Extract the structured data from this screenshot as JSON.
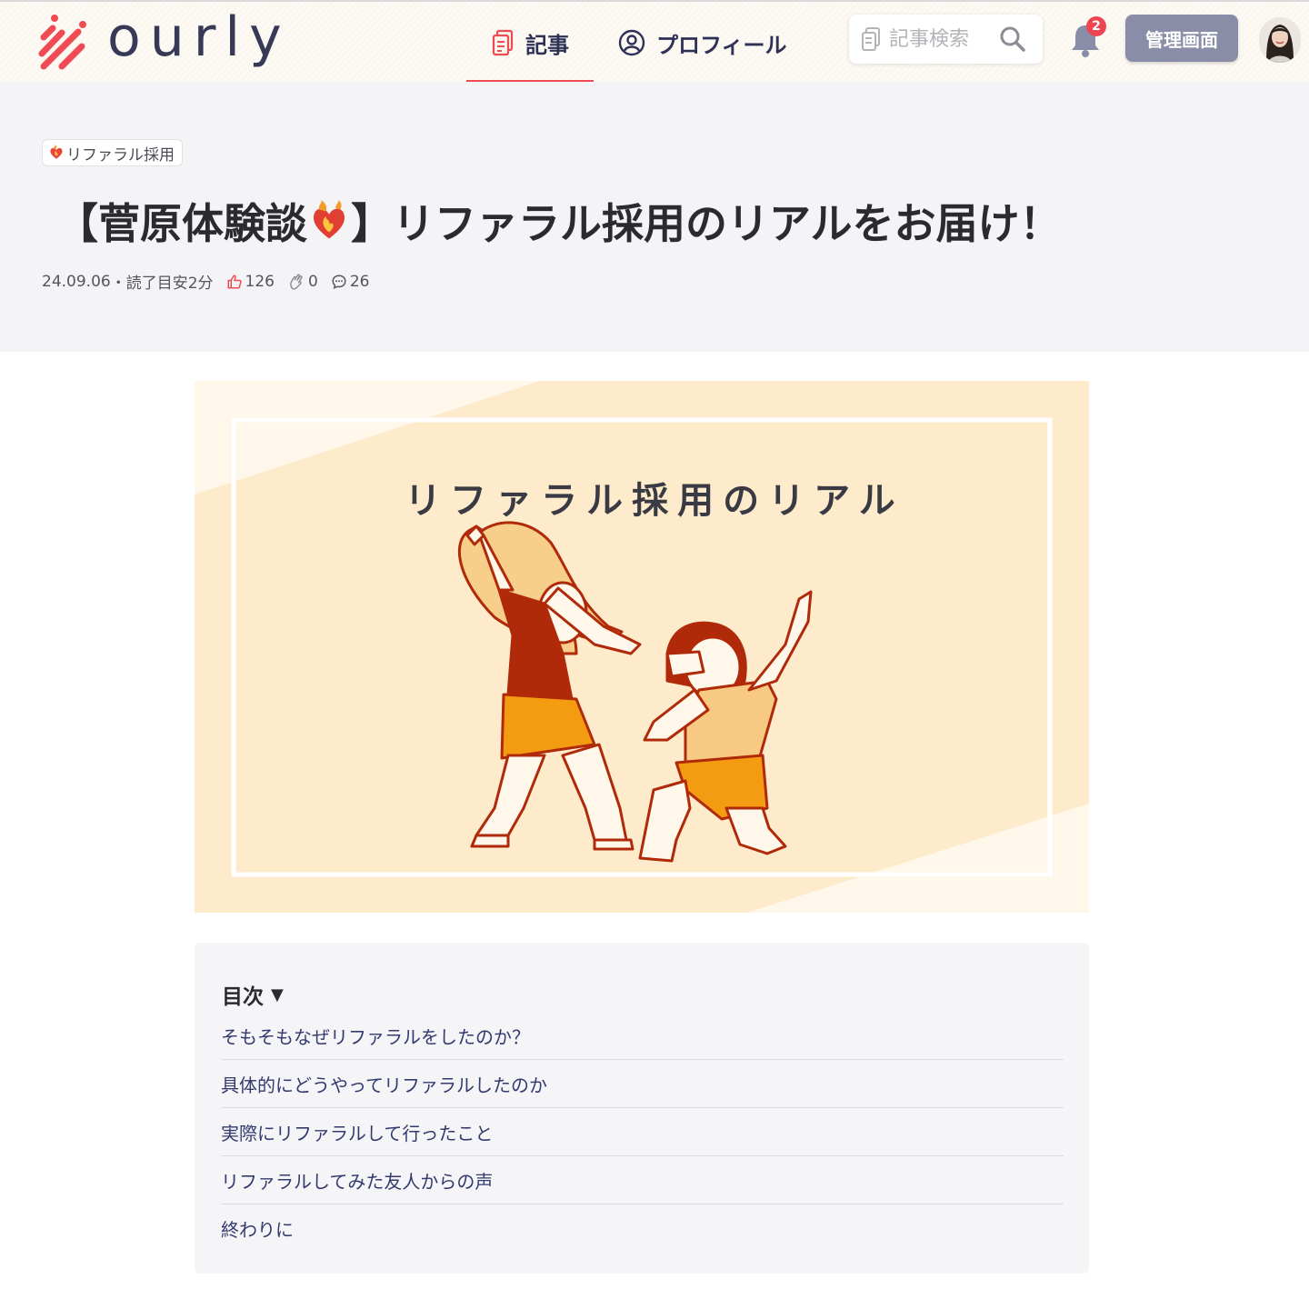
{
  "header": {
    "logo_text": "ourly",
    "nav": [
      {
        "label": "記事",
        "icon": "document-icon",
        "active": true
      },
      {
        "label": "プロフィール",
        "icon": "user-circle-icon",
        "active": false
      }
    ],
    "search_placeholder": "記事検索",
    "notification_count": "2",
    "admin_button_label": "管理画面",
    "colors": {
      "accent": "#ef4b55",
      "nav_text": "#2e3156",
      "admin_button": "#8a8da8"
    }
  },
  "article": {
    "tag": "リファラル採用",
    "title_prefix": "【菅原体験談",
    "title_suffix": "】リファラル採用のリアルをお届け！",
    "date": "24.09.06",
    "reading_time": "・読了目安2分",
    "likes": "126",
    "claps": "0",
    "comments": "26"
  },
  "hero": {
    "caption": "リファラル採用のリアル",
    "colors": {
      "background": "#fdebcb",
      "dark": "#b02a0a",
      "orange": "#f39c12"
    }
  },
  "toc": {
    "title": "目次",
    "arrow": "▼",
    "items": [
      "そもそもなぜリファラルをしたのか？",
      "具体的にどうやってリファラルしたのか",
      "実際にリファラルして行ったこと",
      "リファラルしてみた友人からの声",
      "終わりに"
    ]
  }
}
